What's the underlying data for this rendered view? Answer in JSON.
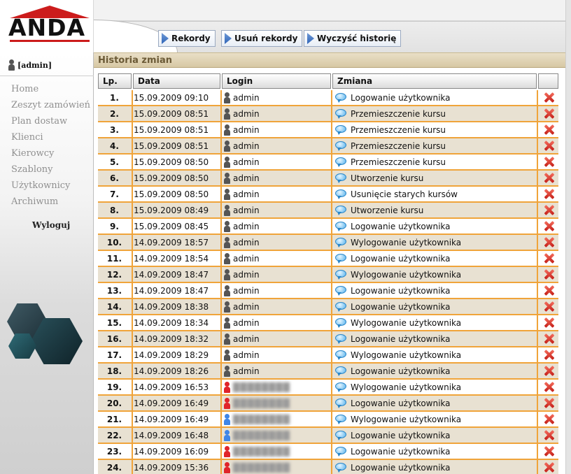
{
  "header": {
    "logo_text": "ANDA",
    "toolbar": [
      {
        "label": "Rekordy"
      },
      {
        "label": "Usuń rekordy"
      },
      {
        "label": "Wyczyść historię"
      }
    ]
  },
  "sidebar": {
    "user": "[admin]",
    "nav": [
      {
        "label": "Home"
      },
      {
        "label": "Zeszyt zamówień"
      },
      {
        "label": "Plan dostaw"
      },
      {
        "label": "Klienci"
      },
      {
        "label": "Kierowcy"
      },
      {
        "label": "Szablony"
      },
      {
        "label": "Użytkownicy"
      },
      {
        "label": "Archiwum"
      }
    ],
    "logout": "Wyloguj"
  },
  "section": {
    "title": "Historia zmian"
  },
  "table": {
    "headers": {
      "lp": "Lp.",
      "date": "Data",
      "login": "Login",
      "change": "Zmiana"
    },
    "rows": [
      {
        "lp": "1.",
        "date": "15.09.2009 09:10",
        "login": "admin",
        "user_icon": "grey",
        "change": "Logowanie użytkownika"
      },
      {
        "lp": "2.",
        "date": "15.09.2009 08:51",
        "login": "admin",
        "user_icon": "grey",
        "change": "Przemieszczenie kursu"
      },
      {
        "lp": "3.",
        "date": "15.09.2009 08:51",
        "login": "admin",
        "user_icon": "grey",
        "change": "Przemieszczenie kursu"
      },
      {
        "lp": "4.",
        "date": "15.09.2009 08:51",
        "login": "admin",
        "user_icon": "grey",
        "change": "Przemieszczenie kursu"
      },
      {
        "lp": "5.",
        "date": "15.09.2009 08:50",
        "login": "admin",
        "user_icon": "grey",
        "change": "Przemieszczenie kursu"
      },
      {
        "lp": "6.",
        "date": "15.09.2009 08:50",
        "login": "admin",
        "user_icon": "grey",
        "change": "Utworzenie kursu"
      },
      {
        "lp": "7.",
        "date": "15.09.2009 08:50",
        "login": "admin",
        "user_icon": "grey",
        "change": "Usunięcie starych kursów"
      },
      {
        "lp": "8.",
        "date": "15.09.2009 08:49",
        "login": "admin",
        "user_icon": "grey",
        "change": "Utworzenie kursu"
      },
      {
        "lp": "9.",
        "date": "15.09.2009 08:45",
        "login": "admin",
        "user_icon": "grey",
        "change": "Logowanie użytkownika"
      },
      {
        "lp": "10.",
        "date": "14.09.2009 18:57",
        "login": "admin",
        "user_icon": "grey",
        "change": "Wylogowanie użytkownika"
      },
      {
        "lp": "11.",
        "date": "14.09.2009 18:54",
        "login": "admin",
        "user_icon": "grey",
        "change": "Logowanie użytkownika"
      },
      {
        "lp": "12.",
        "date": "14.09.2009 18:47",
        "login": "admin",
        "user_icon": "grey",
        "change": "Wylogowanie użytkownika"
      },
      {
        "lp": "13.",
        "date": "14.09.2009 18:47",
        "login": "admin",
        "user_icon": "grey",
        "change": "Logowanie użytkownika"
      },
      {
        "lp": "14.",
        "date": "14.09.2009 18:38",
        "login": "admin",
        "user_icon": "grey",
        "change": "Logowanie użytkownika"
      },
      {
        "lp": "15.",
        "date": "14.09.2009 18:34",
        "login": "admin",
        "user_icon": "grey",
        "change": "Wylogowanie użytkownika"
      },
      {
        "lp": "16.",
        "date": "14.09.2009 18:32",
        "login": "admin",
        "user_icon": "grey",
        "change": "Logowanie użytkownika"
      },
      {
        "lp": "17.",
        "date": "14.09.2009 18:29",
        "login": "admin",
        "user_icon": "grey",
        "change": "Wylogowanie użytkownika"
      },
      {
        "lp": "18.",
        "date": "14.09.2009 18:26",
        "login": "admin",
        "user_icon": "grey",
        "change": "Logowanie użytkownika"
      },
      {
        "lp": "19.",
        "date": "14.09.2009 16:53",
        "login": "",
        "user_icon": "red",
        "change": "Wylogowanie użytkownika"
      },
      {
        "lp": "20.",
        "date": "14.09.2009 16:49",
        "login": "",
        "user_icon": "red",
        "change": "Logowanie użytkownika"
      },
      {
        "lp": "21.",
        "date": "14.09.2009 16:49",
        "login": "",
        "user_icon": "blue",
        "change": "Wylogowanie użytkownika"
      },
      {
        "lp": "22.",
        "date": "14.09.2009 16:48",
        "login": "",
        "user_icon": "blue",
        "change": "Logowanie użytkownika"
      },
      {
        "lp": "23.",
        "date": "14.09.2009 16:09",
        "login": "",
        "user_icon": "red",
        "change": "Logowanie użytkownika"
      },
      {
        "lp": "24.",
        "date": "14.09.2009 15:36",
        "login": "",
        "user_icon": "red",
        "change": "Logowanie użytkownika"
      }
    ]
  },
  "colors": {
    "accent_orange": "#f0a43a",
    "row_alt": "#e8e1d2",
    "section_bar": "#d7c8a4",
    "logo_red": "#cc1c1c",
    "delete_red": "#c6211b"
  },
  "icons": {
    "toolbar_button": "arrow-right-icon",
    "user": "user-icon",
    "change": "speech-bubble-icon",
    "delete": "delete-x-icon"
  }
}
